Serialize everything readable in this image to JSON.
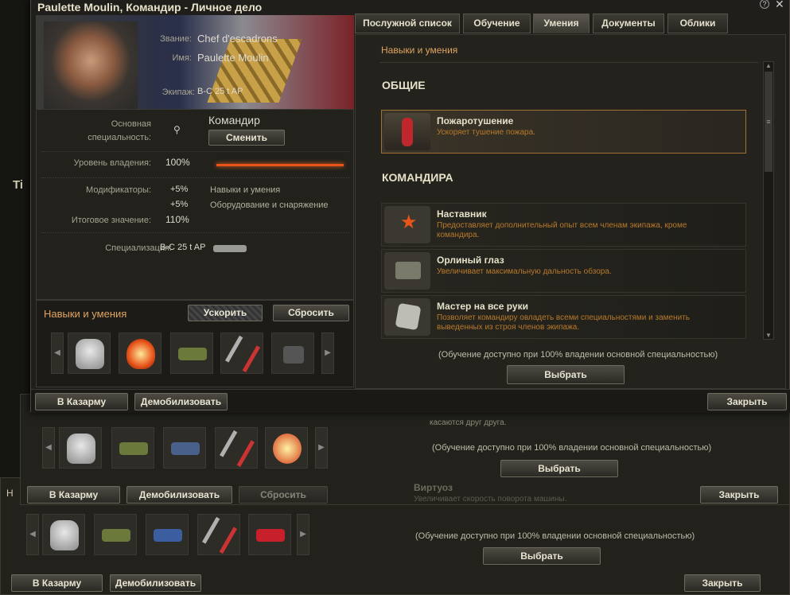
{
  "title": "Paulette Moulin, Командир - Личное дело",
  "profile": {
    "rank_label": "Звание:",
    "rank": "Chef d'escadrons",
    "name_label": "Имя:",
    "name": "Paulette Moulin",
    "crew_label": "Экипаж:",
    "crew": "B-C 25 t AP"
  },
  "tabs": [
    "Послужной список",
    "Обучение",
    "Умения",
    "Документы",
    "Облики"
  ],
  "info": {
    "specialty_label": "Основная специальность:",
    "specialty": "Командир",
    "change_btn": "Сменить",
    "mastery_label": "Уровень владения:",
    "mastery": "100%",
    "mastery_fill": 1.0,
    "mods_label": "Модификаторы:",
    "mod1": "+5%",
    "mod1_desc": "Навыки и умения",
    "mod2": "+5%",
    "mod2_desc": "Оборудование и снаряжение",
    "total_label": "Итоговое значение:",
    "total": "110%",
    "spec_label": "Специализация:",
    "spec": "B-C 25 t AP"
  },
  "skills_panel": {
    "title": "Навыки и умения",
    "speedup": "Ускорить",
    "reset": "Сбросить"
  },
  "right": {
    "header": "Навыки и умения",
    "common_title": "ОБЩИЕ",
    "commander_title": "КОМАНДИРА",
    "perks": [
      {
        "name": "Пожаротушение",
        "desc": "Ускоряет тушение пожара."
      },
      {
        "name": "Наставник",
        "desc": "Предоставляет дополнительный опыт всем членам экипажа, кроме командира."
      },
      {
        "name": "Орлиный глаз",
        "desc": "Увеличивает максимальную дальность обзора."
      },
      {
        "name": "Мастер на все руки",
        "desc": "Позволяет командиру овладеть всеми специальностями и заменить выведенных из строя членов экипажа."
      }
    ],
    "note": "(Обучение доступно при 100% владении основной специальностью)",
    "choose": "Выбрать"
  },
  "footer": {
    "barracks": "В Казарму",
    "demob": "Демобилизовать",
    "close": "Закрыть"
  },
  "bg": {
    "fragment_text": "касаются друг друга.",
    "virtuoso": "Виртуоз",
    "virtuoso_desc": "Увеличивает скорость поворота машины.",
    "reset": "Сбросить",
    "tab_letters": "Ti",
    "h_letter": "Н"
  }
}
